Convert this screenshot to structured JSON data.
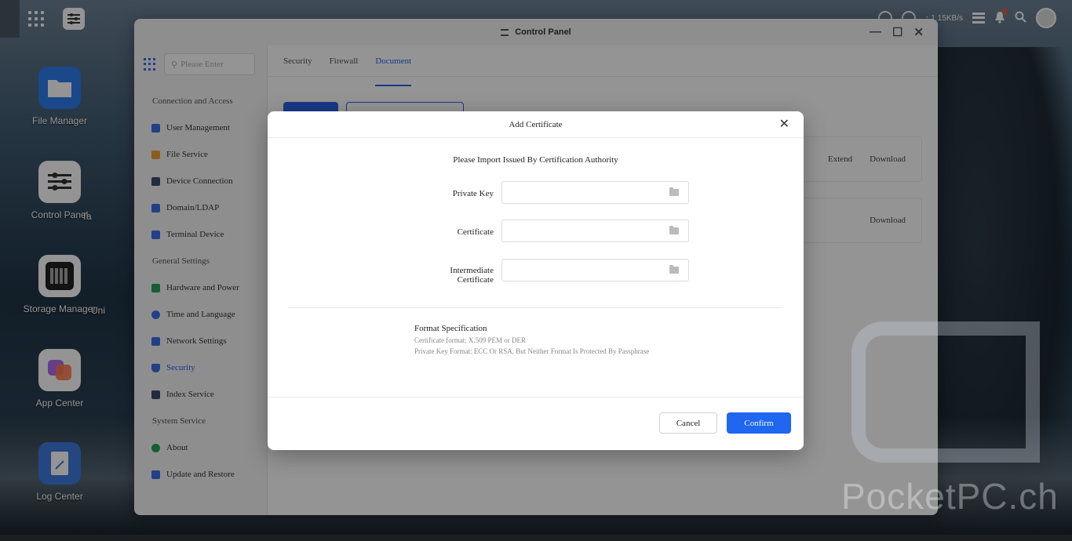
{
  "topbar": {
    "speed": "↑ 1.15KB/s"
  },
  "desktop": {
    "icons": [
      {
        "label": "File Manager",
        "color": "#2e7df0"
      },
      {
        "label": "Control Panel",
        "color": "#ffffff"
      },
      {
        "label": "Storage Manager",
        "color": "#ffffff"
      },
      {
        "label": "App Center",
        "color": "#ffffff"
      },
      {
        "label": "Log Center",
        "color": "#3e7ae0"
      }
    ],
    "partial_labels": [
      "Ta",
      "Uni"
    ]
  },
  "window": {
    "title": "Control Panel",
    "search_placeholder": "Please Enter",
    "sidebar": {
      "sections": [
        "Connection and Access",
        "General Settings",
        "System Service"
      ],
      "items": [
        {
          "label": "User Management",
          "color": "#3a6ee8"
        },
        {
          "label": "File Service",
          "color": "#f0a030"
        },
        {
          "label": "Device Connection",
          "color": "#3a4a6a"
        },
        {
          "label": "Domain/LDAP",
          "color": "#3a6ee8"
        },
        {
          "label": "Terminal Device",
          "color": "#3a6ee8"
        },
        {
          "label": "Hardware and Power",
          "color": "#29a35a"
        },
        {
          "label": "Time and Language",
          "color": "#3a6ee8"
        },
        {
          "label": "Network Settings",
          "color": "#3a6ee8"
        },
        {
          "label": "Security",
          "color": "#3a6ee8"
        },
        {
          "label": "Index Service",
          "color": "#3a4a6a"
        },
        {
          "label": "About",
          "color": "#29a35a"
        },
        {
          "label": "Update and Restore",
          "color": "#3a6ee8"
        }
      ]
    },
    "tabs": [
      "Security",
      "Firewall",
      "Document"
    ],
    "rows": [
      {
        "actions": [
          "Extend",
          "Download"
        ]
      },
      {
        "actions": [
          "Download"
        ]
      }
    ]
  },
  "dialog": {
    "title": "Add Certificate",
    "subtitle": "Please Import Issued By Certification Authority",
    "fields": [
      {
        "label": "Private Key",
        "value": ""
      },
      {
        "label": "Certificate",
        "value": ""
      },
      {
        "label_line1": "Intermediate",
        "label_line2": "Certificate",
        "value": ""
      }
    ],
    "format": {
      "title": "Format Specification",
      "line1": "Certificate format: X.509 PEM or DER",
      "line2": "Private Key Format: ECC Or RSA, But Neither Format Is Protected By Passphrase"
    },
    "cancel_label": "Cancel",
    "confirm_label": "Confirm"
  },
  "watermark": "PocketPC.ch"
}
